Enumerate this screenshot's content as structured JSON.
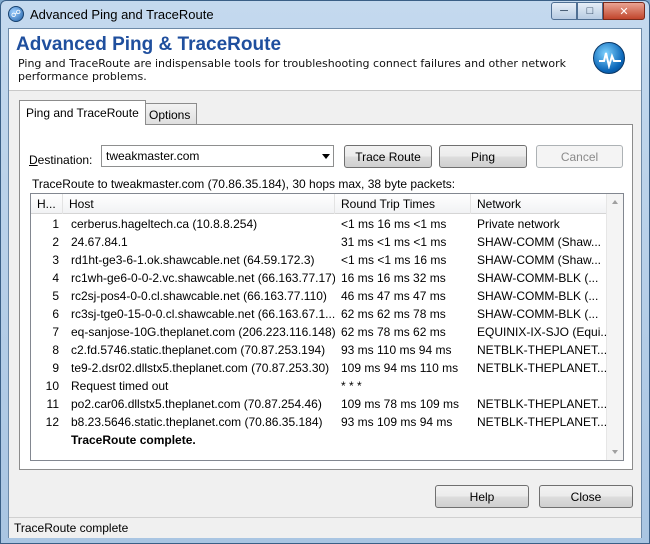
{
  "window": {
    "title": "Advanced Ping and TraceRoute"
  },
  "header": {
    "title": "Advanced Ping & TraceRoute",
    "description": "Ping and TraceRoute are indispensable tools for troubleshooting connect failures and other network performance problems."
  },
  "tabs": [
    {
      "label": "Ping and TraceRoute",
      "active": true
    },
    {
      "label": "Options",
      "active": false
    }
  ],
  "form": {
    "destination_label_prefix": "D",
    "destination_label_rest": "estination:",
    "destination_value": "tweakmaster.com",
    "trace_button": "Trace Route",
    "ping_button": "Ping",
    "cancel_button": "Cancel"
  },
  "summary": "TraceRoute to tweakmaster.com (70.86.35.184), 30 hops max, 38 byte packets:",
  "table": {
    "columns": [
      "H...",
      "Host",
      "Round Trip Times",
      "Network"
    ],
    "rows": [
      {
        "hop": "1",
        "host": "cerberus.hageltech.ca (10.8.8.254)",
        "rtt": "<1 ms 16 ms <1 ms",
        "network": "Private network"
      },
      {
        "hop": "2",
        "host": "24.67.84.1",
        "rtt": "31 ms <1 ms <1 ms",
        "network": "SHAW-COMM (Shaw..."
      },
      {
        "hop": "3",
        "host": "rd1ht-ge3-6-1.ok.shawcable.net (64.59.172.3)",
        "rtt": "<1 ms <1 ms 16 ms",
        "network": "SHAW-COMM (Shaw..."
      },
      {
        "hop": "4",
        "host": "rc1wh-ge6-0-0-2.vc.shawcable.net (66.163.77.17)",
        "rtt": "16 ms 16 ms 32 ms",
        "network": "SHAW-COMM-BLK (..."
      },
      {
        "hop": "5",
        "host": "rc2sj-pos4-0-0.cl.shawcable.net (66.163.77.110)",
        "rtt": "46 ms 47 ms 47 ms",
        "network": "SHAW-COMM-BLK (..."
      },
      {
        "hop": "6",
        "host": "rc3sj-tge0-15-0-0.cl.shawcable.net (66.163.67.1...",
        "rtt": "62 ms 62 ms 78 ms",
        "network": "SHAW-COMM-BLK (..."
      },
      {
        "hop": "7",
        "host": "eq-sanjose-10G.theplanet.com (206.223.116.148)",
        "rtt": "62 ms 78 ms 62 ms",
        "network": "EQUINIX-IX-SJO (Equi..."
      },
      {
        "hop": "8",
        "host": "c2.fd.5746.static.theplanet.com (70.87.253.194)",
        "rtt": "93 ms 110 ms 94 ms",
        "network": "NETBLK-THEPLANET..."
      },
      {
        "hop": "9",
        "host": "te9-2.dsr02.dllstx5.theplanet.com (70.87.253.30)",
        "rtt": "109 ms 94 ms 110 ms",
        "network": "NETBLK-THEPLANET..."
      },
      {
        "hop": "10",
        "host": "Request timed out",
        "rtt": "* * *",
        "network": ""
      },
      {
        "hop": "11",
        "host": "po2.car06.dllstx5.theplanet.com (70.87.254.46)",
        "rtt": "109 ms 78 ms 109 ms",
        "network": "NETBLK-THEPLANET..."
      },
      {
        "hop": "12",
        "host": "b8.23.5646.static.theplanet.com (70.86.35.184)",
        "rtt": "93 ms 109 ms 94 ms",
        "network": "NETBLK-THEPLANET..."
      },
      {
        "hop": "",
        "host": "TraceRoute complete.",
        "rtt": "",
        "network": "",
        "complete": true
      }
    ]
  },
  "footer": {
    "help_button": "Help",
    "close_button": "Close"
  },
  "status": "TraceRoute complete"
}
